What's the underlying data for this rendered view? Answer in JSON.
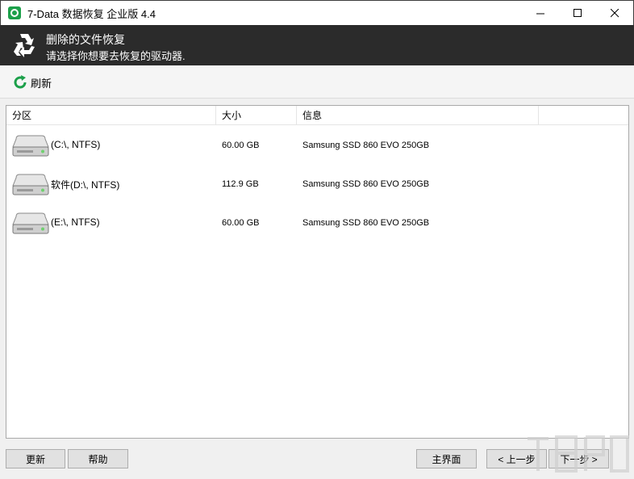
{
  "window": {
    "title": "7-Data 数据恢复 企业版 4.4",
    "controls": {
      "minimize": "—",
      "maximize": "☐",
      "close": "✕"
    }
  },
  "header": {
    "title": "删除的文件恢复",
    "subtitle": "请选择你想要去恢复的驱动器."
  },
  "toolbar": {
    "refresh_label": "刷新"
  },
  "table": {
    "columns": [
      "分区",
      "大小",
      "信息",
      ""
    ],
    "rows": [
      {
        "name": "(C:\\, NTFS)",
        "size": "60.00 GB",
        "info": "Samsung SSD 860 EVO 250GB"
      },
      {
        "name": "软件(D:\\, NTFS)",
        "size": "112.9 GB",
        "info": "Samsung SSD 860 EVO 250GB"
      },
      {
        "name": "(E:\\, NTFS)",
        "size": "60.00 GB",
        "info": "Samsung SSD 860 EVO 250GB"
      }
    ]
  },
  "footer": {
    "update_label": "更新",
    "help_label": "帮助",
    "main_label": "主界面",
    "prev_label": "< 上一步",
    "next_label": "下一步 >"
  },
  "colors": {
    "header_bg": "#2b2b2b",
    "accent_green": "#1ca04a"
  }
}
